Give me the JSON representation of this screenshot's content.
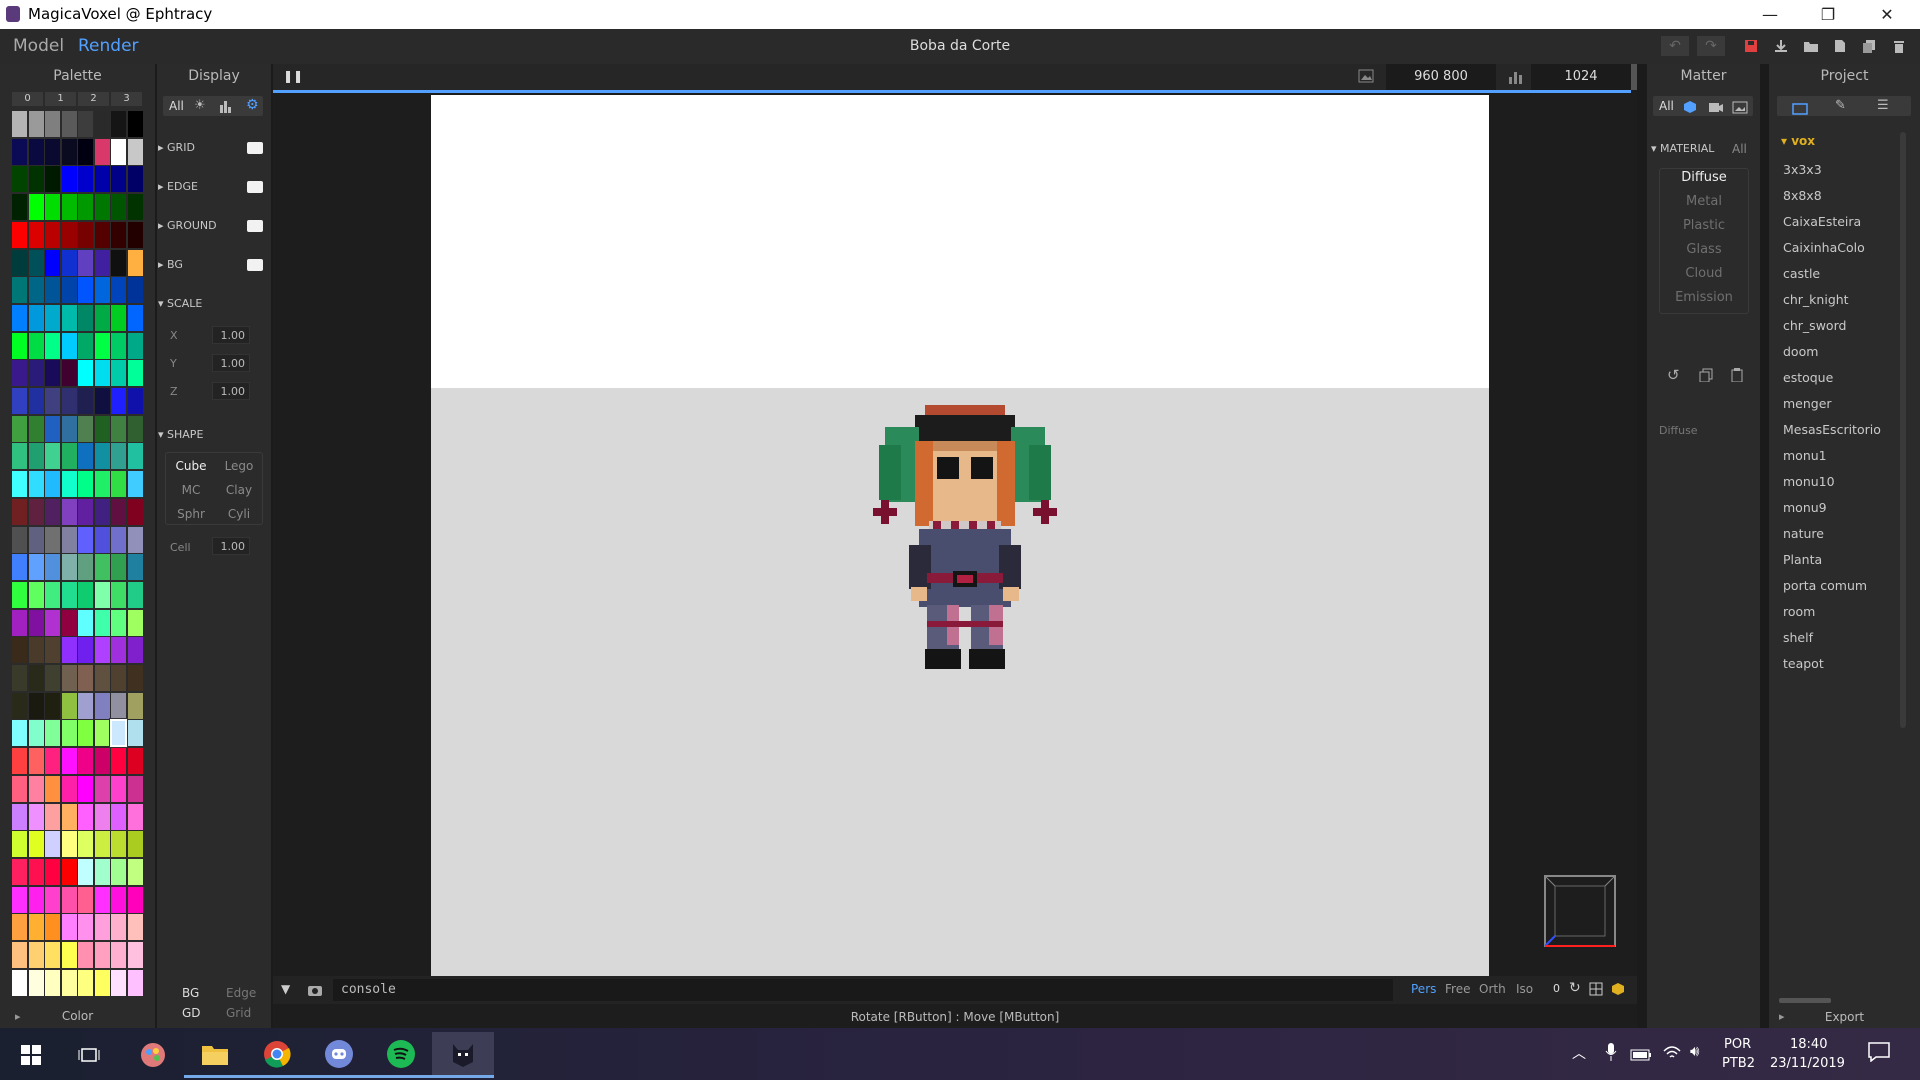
{
  "window": {
    "title": "MagicaVoxel @ Ephtracy",
    "minimize": "—",
    "restore": "❐",
    "close": "✕"
  },
  "menu": {
    "model_tab": "Model",
    "render_tab": "Render",
    "doc_title": "Boba da Corte"
  },
  "toolbar_icons": [
    "undo-icon",
    "redo-icon",
    "save-icon",
    "import-icon",
    "open-folder-icon",
    "new-file-icon",
    "copy-file-icon",
    "delete-icon"
  ],
  "palette": {
    "header": "Palette",
    "tabs": [
      "0",
      "1",
      "2",
      "3"
    ],
    "footer": "Color",
    "selected": {
      "row": 22,
      "col": 6
    },
    "rows": [
      [
        "#b4b4b4",
        "#9a9a9a",
        "#7f7f7f",
        "#5a5a5a",
        "#3d3d3d",
        "#2a2a2a",
        "#151515",
        "#000000"
      ],
      [
        "#0a0a55",
        "#0a0a40",
        "#0a0a30",
        "#0a0a20",
        "#000010",
        "#d8386a",
        "#ffffff",
        "#c8c8c8"
      ],
      [
        "#004400",
        "#003300",
        "#001a00",
        "#0000ff",
        "#0000cc",
        "#0000aa",
        "#000088",
        "#000066"
      ],
      [
        "#002200",
        "#00ff00",
        "#00dd00",
        "#00bb00",
        "#009900",
        "#007700",
        "#005500",
        "#003300"
      ],
      [
        "#ff0000",
        "#dd0000",
        "#bb0000",
        "#990000",
        "#770000",
        "#550000",
        "#330000",
        "#220000"
      ],
      [
        "#003c3c",
        "#00505a",
        "#0000ff",
        "#1030d0",
        "#6040c0",
        "#4020a0",
        "#101010",
        "#ffb040"
      ],
      [
        "#007777",
        "#006688",
        "#005599",
        "#0044aa",
        "#0055ff",
        "#0066dd",
        "#0044bb",
        "#003399"
      ],
      [
        "#0080ff",
        "#0099dd",
        "#00aacc",
        "#00bbaa",
        "#008866",
        "#00aa44",
        "#00cc22",
        "#0066ff"
      ],
      [
        "#00ff22",
        "#00dd44",
        "#00ff88",
        "#00ccff",
        "#00aa66",
        "#00ff44",
        "#00cc66",
        "#00aa88"
      ],
      [
        "#3a1a8a",
        "#2a1a7a",
        "#1a0a5a",
        "#400030",
        "#00ffff",
        "#00ddee",
        "#00ccaa",
        "#00ff99"
      ],
      [
        "#3040c0",
        "#2030a0",
        "#404080",
        "#303070",
        "#202050",
        "#101040",
        "#2020ff",
        "#1010aa"
      ],
      [
        "#40a040",
        "#308030",
        "#2060c0",
        "#3070a0",
        "#508050",
        "#206020",
        "#408040",
        "#306030"
      ],
      [
        "#30c080",
        "#20a070",
        "#40d090",
        "#20b060",
        "#1070c0",
        "#1090a0",
        "#30a090",
        "#20c0a0"
      ],
      [
        "#40ffff",
        "#30ddff",
        "#20bbff",
        "#10ffcc",
        "#00ff88",
        "#20ee66",
        "#30dd44",
        "#40ccff"
      ],
      [
        "#702020",
        "#602040",
        "#502060",
        "#8040c0",
        "#6020a0",
        "#402080",
        "#601040",
        "#800020"
      ],
      [
        "#505050",
        "#606080",
        "#707070",
        "#8080a0",
        "#6060ff",
        "#5050dd",
        "#7070cc",
        "#9090bb"
      ],
      [
        "#4080ff",
        "#60a0ff",
        "#5090dd",
        "#80b0aa",
        "#60a080",
        "#40c060",
        "#30a050",
        "#2080a0"
      ],
      [
        "#30ff40",
        "#60ff60",
        "#40ee80",
        "#20dd90",
        "#10cc70",
        "#80ffaa",
        "#40dd66",
        "#20cc88"
      ],
      [
        "#a020c0",
        "#8010a0",
        "#b030d0",
        "#900040",
        "#60ffff",
        "#40ffaa",
        "#60ff80",
        "#a0ff60"
      ],
      [
        "#3a2a1a",
        "#4a3a2a",
        "#504030",
        "#9030ff",
        "#7020ee",
        "#b040ff",
        "#a030dd",
        "#8020cc"
      ],
      [
        "#3a3a2a",
        "#2a2a1a",
        "#404030",
        "#706050",
        "#806050",
        "#605040",
        "#504030",
        "#403020"
      ],
      [
        "#2a2a1a",
        "#1a1a10",
        "#202010",
        "#90c040",
        "#a0a0d0",
        "#8080c0",
        "#9090a0",
        "#a0a060"
      ],
      [
        "#80ffff",
        "#80ffcc",
        "#80ff99",
        "#80ff66",
        "#80ff40",
        "#a0ff60",
        "#cce8ff",
        "#b0e0ee"
      ],
      [
        "#ff4040",
        "#ff6060",
        "#ff2080",
        "#ff10ff",
        "#ee0088",
        "#cc0066",
        "#ff0040",
        "#dd0020"
      ],
      [
        "#ff6080",
        "#ff80a0",
        "#ff9040",
        "#ff20aa",
        "#ff00ff",
        "#dd40aa",
        "#ff40cc",
        "#cc3090"
      ],
      [
        "#cc80ff",
        "#ee90ff",
        "#ffa0a0",
        "#ffb060",
        "#ff60ff",
        "#ee80ee",
        "#dd60ff",
        "#ff70dd"
      ],
      [
        "#d0ff30",
        "#e0ff20",
        "#d0d0ff",
        "#ffff80",
        "#ddff60",
        "#ccee40",
        "#bbdd30",
        "#aacc20"
      ],
      [
        "#ff2060",
        "#ff1050",
        "#ff0040",
        "#ff0000",
        "#c0ffff",
        "#a0ffcc",
        "#a0ff90",
        "#c0ff80"
      ],
      [
        "#ff30ff",
        "#ff20ee",
        "#ff40cc",
        "#ff50aa",
        "#ff6090",
        "#ff30ff",
        "#ff10dd",
        "#ff00bb"
      ],
      [
        "#ffa040",
        "#ffb030",
        "#ff9020",
        "#ff80ff",
        "#ff90ee",
        "#ffa0dd",
        "#ffb0cc",
        "#ffc0bb"
      ],
      [
        "#ffc080",
        "#ffd070",
        "#ffe060",
        "#ffff50",
        "#ff90b0",
        "#ffa0c0",
        "#ffb0d0",
        "#ffc0e0"
      ],
      [
        "#ffffff",
        "#ffffe0",
        "#ffffc0",
        "#ffffa0",
        "#ffff80",
        "#ffff60",
        "#ffe0ff",
        "#ffc0ff"
      ]
    ]
  },
  "display": {
    "header": "Display",
    "tabs": [
      "All",
      "light-icon",
      "chart-icon",
      "gear-icon"
    ],
    "toggles": [
      "GRID",
      "EDGE",
      "GROUND",
      "BG"
    ],
    "scale_title": "SCALE",
    "scale": [
      {
        "axis": "X",
        "value": "1.00"
      },
      {
        "axis": "Y",
        "value": "1.00"
      },
      {
        "axis": "Z",
        "value": "1.00"
      }
    ],
    "shape_title": "SHAPE",
    "shapes": [
      "Cube",
      "Lego",
      "MC",
      "Clay",
      "Sphr",
      "Cyli"
    ],
    "cell_label": "Cell",
    "cell_value": "1.00",
    "bottom_left": [
      "BG",
      "GD"
    ],
    "bottom_right": [
      "Edge",
      "Grid"
    ]
  },
  "viewport": {
    "size_text": "960 800",
    "samples": "1024",
    "console": "console",
    "status": "Rotate [RButton] : Move [MButton]",
    "view_modes": [
      "Pers",
      "Free",
      "Orth",
      "Iso",
      "0"
    ]
  },
  "matter": {
    "header": "Matter",
    "tabs": [
      "All",
      "cube-icon",
      "camera-icon",
      "image-icon"
    ],
    "material_title": "MATERIAL",
    "material_all": "All",
    "materials": [
      "Diffuse",
      "Metal",
      "Plastic",
      "Glass",
      "Cloud",
      "Emission"
    ],
    "current": "Diffuse"
  },
  "project": {
    "header": "Project",
    "folder": "vox",
    "files": [
      "3x3x3",
      "8x8x8",
      "CaixaEsteira",
      "CaixinhaColo",
      "castle",
      "chr_knight",
      "chr_sword",
      "doom",
      "estoque",
      "menger",
      "MesasEscritorio",
      "monu1",
      "monu10",
      "monu9",
      "nature",
      "Planta",
      "porta comum",
      "room",
      "shelf",
      "teapot"
    ],
    "footer": "Export"
  },
  "taskbar": {
    "lang1": "POR",
    "lang2": "PTB2",
    "time": "18:40",
    "date": "23/11/2019"
  },
  "colors": {
    "accent": "#52a0ff",
    "panel": "#2b2b2b",
    "save_red": "#e04040"
  }
}
